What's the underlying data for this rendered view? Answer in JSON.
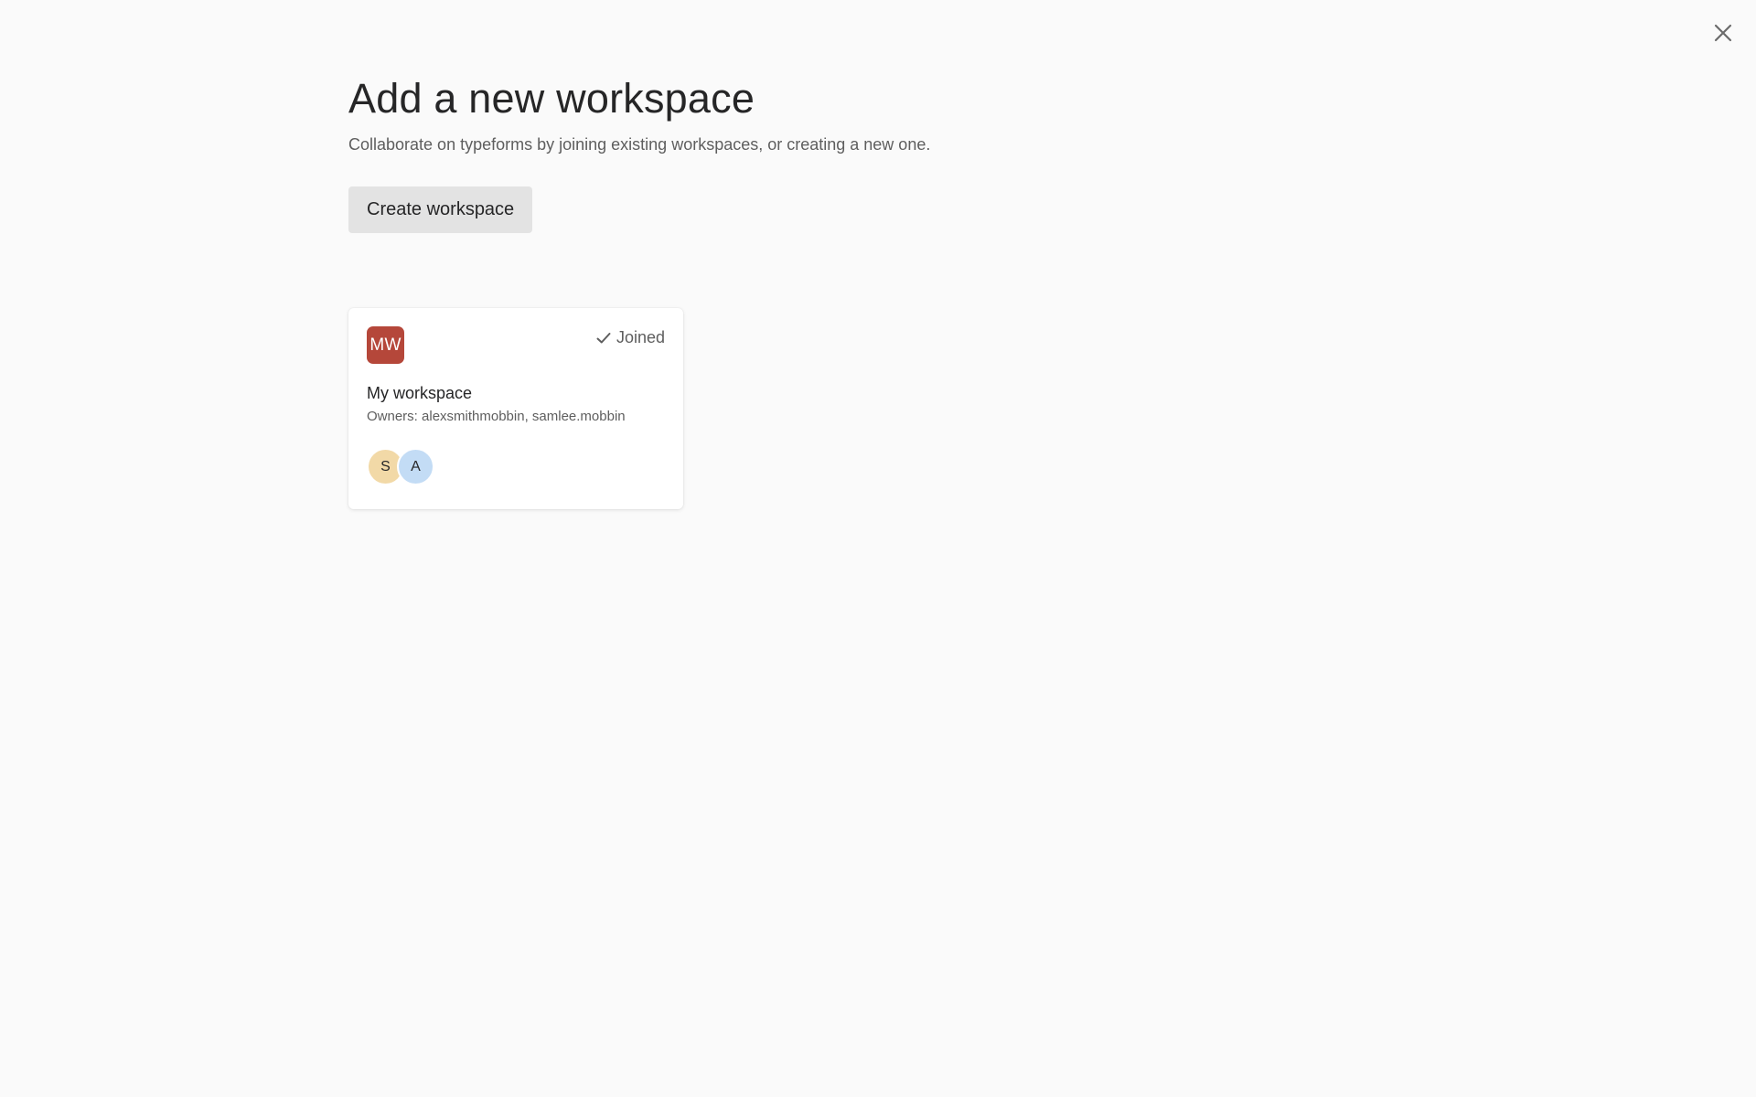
{
  "header": {
    "title": "Add a new workspace",
    "subtitle": "Collaborate on typeforms by joining existing workspaces, or creating a new one.",
    "close_icon": "close-icon"
  },
  "actions": {
    "create_label": "Create workspace"
  },
  "workspaces": [
    {
      "initials": "MW",
      "avatar_color": "#b5473a",
      "status_label": "Joined",
      "status_icon": "check-icon",
      "name": "My workspace",
      "owners_text": "Owners: alexsmithmobbin, samlee.mobbin",
      "members": [
        {
          "initial": "S",
          "color": "#f2d9a7"
        },
        {
          "initial": "A",
          "color": "#c3dcf5"
        }
      ]
    }
  ]
}
